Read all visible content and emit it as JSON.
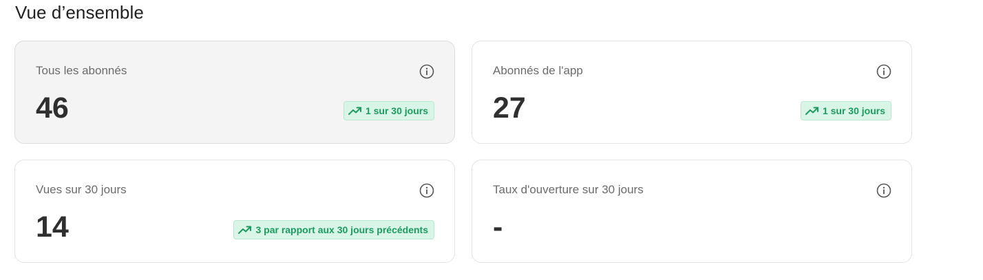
{
  "page": {
    "title": "Vue d’ensemble"
  },
  "colors": {
    "trend_green": "#1a9c5f",
    "badge_bg": "#d9f5e8",
    "highlight_bg": "#f4f4f4"
  },
  "cards": [
    {
      "label": "Tous les abonnés",
      "value": "46",
      "trend": "1 sur 30 jours",
      "trend_icon": "trending-up-icon",
      "info_icon": "info-icon",
      "highlighted": true
    },
    {
      "label": "Abonnés de l'app",
      "value": "27",
      "trend": "1 sur 30 jours",
      "trend_icon": "trending-up-icon",
      "info_icon": "info-icon",
      "highlighted": false
    },
    {
      "label": "Vues sur 30 jours",
      "value": "14",
      "trend": "3 par rapport aux 30 jours précédents",
      "trend_icon": "trending-up-icon",
      "info_icon": "info-icon",
      "highlighted": false
    },
    {
      "label": "Taux d'ouverture sur 30 jours",
      "value": "-",
      "trend": null,
      "info_icon": "info-icon",
      "highlighted": false
    }
  ]
}
